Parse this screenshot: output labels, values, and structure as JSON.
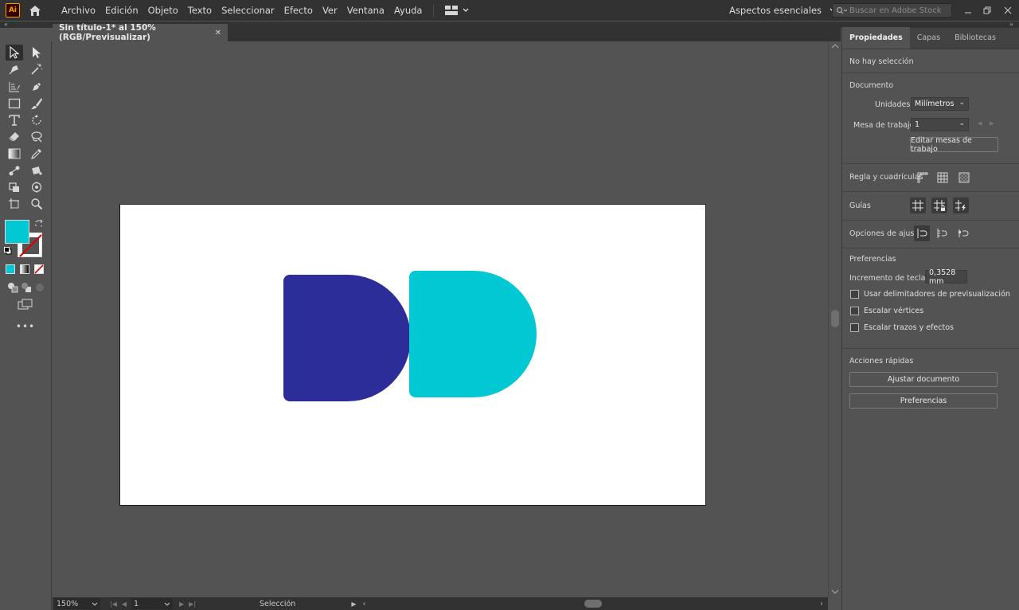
{
  "app": {
    "logo_text": "Ai",
    "menu": [
      "Archivo",
      "Edición",
      "Objeto",
      "Texto",
      "Seleccionar",
      "Efecto",
      "Ver",
      "Ventana",
      "Ayuda"
    ],
    "workspace": "Aspectos esenciales",
    "search_placeholder": "Buscar en Adobe Stock"
  },
  "document": {
    "tab_title": "Sin título-1* al 150% (RGB/Previsualizar)",
    "close_glyph": "✕"
  },
  "canvas": {
    "artboard_color": "#ffffff",
    "shapes": [
      {
        "name": "navy-half-circle-shape",
        "color": "#2d2d9a"
      },
      {
        "name": "cyan-half-circle-shape",
        "color": "#02c8d4"
      }
    ]
  },
  "toolbar": {
    "fill_color": "#02c8d4",
    "stroke": "none"
  },
  "status": {
    "zoom": "150%",
    "artboard_number": "1",
    "tool": "Selección"
  },
  "panel": {
    "tabs": [
      "Propiedades",
      "Capas",
      "Bibliotecas"
    ],
    "selection": "No hay selección",
    "document_heading": "Documento",
    "units_label": "Unidades:",
    "units_value": "Milímetros",
    "artboard_label": "Mesa de trabajo:",
    "artboard_value": "1",
    "edit_artboards": "Editar mesas de trabajo",
    "rulers_label": "Regla y cuadrículas",
    "guides_label": "Guías",
    "snap_label": "Opciones de ajuste",
    "prefs_heading": "Preferencias",
    "key_increment_label": "Incremento de teclado:",
    "key_increment_value": "0,3528 mm",
    "check_preview_bounds": "Usar delimitadores de previsualización",
    "check_scale_corners": "Escalar vértices",
    "check_scale_strokes": "Escalar trazos y efectos",
    "quick_actions": "Acciones rápidas",
    "fit_document": "Ajustar documento",
    "preferences_button": "Preferencias"
  }
}
